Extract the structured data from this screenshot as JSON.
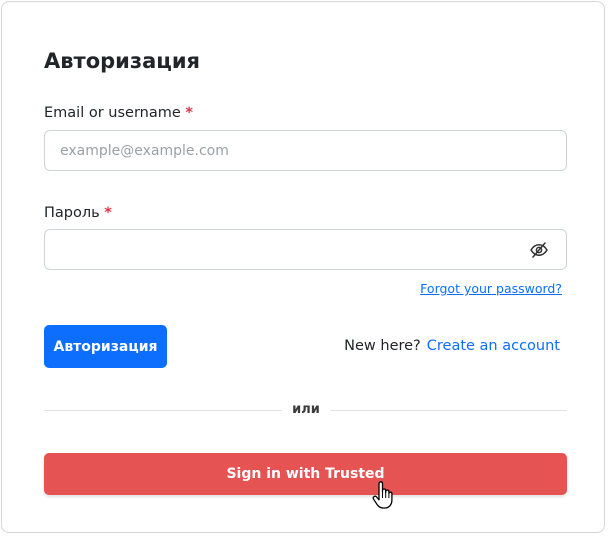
{
  "form": {
    "title": "Авторизация",
    "email_label": "Email or username",
    "email_placeholder": "example@example.com",
    "email_value": "",
    "password_label": "Пароль",
    "password_value": "",
    "required_mark": "*",
    "forgot_link": "Forgot your password?",
    "submit_label": "Авторизация",
    "new_here_text": "New here?",
    "create_account_link": "Create an account",
    "divider_text": "или",
    "trusted_button_label": "Sign in with Trusted"
  },
  "icons": {
    "password_toggle": "eye-slash-icon",
    "pointer": "hand-cursor-icon"
  },
  "colors": {
    "primary": "#0d6efd",
    "trusted": "#e55353",
    "required": "#dc3545",
    "border": "#cfd4da"
  }
}
